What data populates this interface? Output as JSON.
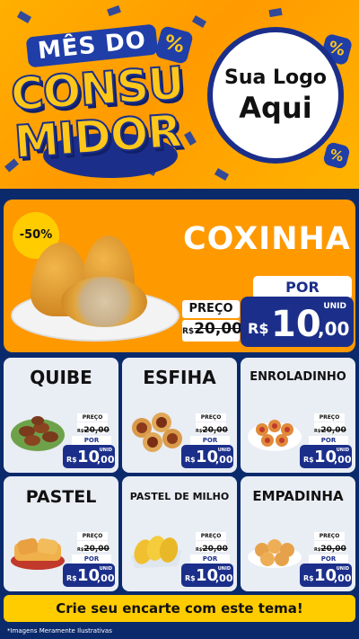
{
  "header": {
    "title_top": "MÊS DO",
    "title_line1": "CONSU",
    "title_line2": "MIDOR",
    "percent_symbol": "%",
    "logo_line1": "Sua Logo",
    "logo_line2": "Aqui"
  },
  "featured": {
    "discount": "-50%",
    "name": "COXINHA",
    "preco_label": "PREÇO",
    "old_currency": "R$",
    "old_value": "20,00",
    "por_label": "POR",
    "unid_label": "UNID",
    "currency": "R$",
    "price_int": "10",
    "price_dec": ",00"
  },
  "products": [
    {
      "name": "QUIBE",
      "preco_label": "PREÇO",
      "old_currency": "R$",
      "old_value": "20,00",
      "por_label": "POR",
      "unid_label": "UNID",
      "currency": "R$",
      "price_int": "10",
      "price_dec": ",00"
    },
    {
      "name": "ESFIHA",
      "preco_label": "PREÇO",
      "old_currency": "R$",
      "old_value": "20,00",
      "por_label": "POR",
      "unid_label": "UNID",
      "currency": "R$",
      "price_int": "10",
      "price_dec": ",00"
    },
    {
      "name": "ENROLADINHO",
      "preco_label": "PREÇO",
      "old_currency": "R$",
      "old_value": "20,00",
      "por_label": "POR",
      "unid_label": "UNID",
      "currency": "R$",
      "price_int": "10",
      "price_dec": ",00"
    },
    {
      "name": "PASTEL",
      "preco_label": "PREÇO",
      "old_currency": "R$",
      "old_value": "20,00",
      "por_label": "POR",
      "unid_label": "UNID",
      "currency": "R$",
      "price_int": "10",
      "price_dec": ",00"
    },
    {
      "name": "PASTEL DE MILHO",
      "preco_label": "PREÇO",
      "old_currency": "R$",
      "old_value": "20,00",
      "por_label": "POR",
      "unid_label": "UNID",
      "currency": "R$",
      "price_int": "10",
      "price_dec": ",00"
    },
    {
      "name": "EMPADINHA",
      "preco_label": "PREÇO",
      "old_currency": "R$",
      "old_value": "20,00",
      "por_label": "POR",
      "unid_label": "UNID",
      "currency": "R$",
      "price_int": "10",
      "price_dec": ",00"
    }
  ],
  "cta": "Crie seu encarte com este tema!",
  "disclaimer": "*Imagens Meramente Ilustrativas",
  "colors": {
    "orange": "#ff9900",
    "navy": "#1b2f8a",
    "background": "#0b2a6b",
    "yellow": "#ffcc00",
    "card": "#e9edf4"
  }
}
